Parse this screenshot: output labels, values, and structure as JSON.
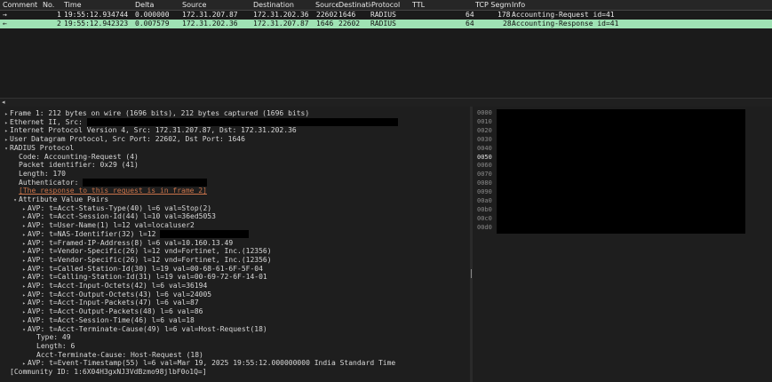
{
  "packet_list": {
    "columns": [
      "Comment",
      "No.",
      "Time",
      "Delta",
      "Source",
      "Destination",
      "Source",
      "Destinatio",
      "Protocol",
      "TTL",
      "TCP Segme",
      "Info"
    ],
    "rows": [
      {
        "arrow": "→",
        "no": "1",
        "time": "19:55:12.934744",
        "delta": "0.000000",
        "src": "172.31.207.87",
        "dst": "172.31.202.36",
        "sport": "22602",
        "dport": "1646",
        "proto": "RADIUS",
        "ttl": "64",
        "len": "178",
        "info": "Accounting-Request id=41"
      },
      {
        "arrow": "←",
        "no": "2",
        "time": "19:55:12.942323",
        "delta": "0.007579",
        "src": "172.31.202.36",
        "dst": "172.31.207.87",
        "sport": "1646",
        "dport": "22602",
        "proto": "RADIUS",
        "ttl": "64",
        "len": "28",
        "info": "Accounting-Response id=41"
      }
    ],
    "selected_row_color": "#9fe2b4"
  },
  "details": {
    "lines": [
      {
        "indent": 0,
        "tw": "▸",
        "text": "Frame 1: 212 bytes on wire (1696 bits), 212 bytes captured (1696 bits)"
      },
      {
        "indent": 0,
        "tw": "▸",
        "text": "Ethernet II, Src: ",
        "redact": 350
      },
      {
        "indent": 0,
        "tw": "▸",
        "text": "Internet Protocol Version 4, Src: 172.31.207.87, Dst: 172.31.202.36"
      },
      {
        "indent": 0,
        "tw": "▸",
        "text": "User Datagram Protocol, Src Port: 22602, Dst Port: 1646"
      },
      {
        "indent": 0,
        "tw": "▾",
        "text": "RADIUS Protocol"
      },
      {
        "indent": 1,
        "tw": "",
        "text": "Code: Accounting-Request (4)"
      },
      {
        "indent": 1,
        "tw": "",
        "text": "Packet identifier: 0x29 (41)"
      },
      {
        "indent": 1,
        "tw": "",
        "text": "Length: 170"
      },
      {
        "indent": 1,
        "tw": "",
        "text": "Authenticator: ",
        "redact": 140
      },
      {
        "indent": 1,
        "tw": "",
        "text": "[The response to this request is in frame 2]",
        "link": true
      },
      {
        "indent": 1,
        "tw": "▾",
        "text": "Attribute Value Pairs"
      },
      {
        "indent": 2,
        "tw": "▸",
        "text": "AVP: t=Acct-Status-Type(40) l=6 val=Stop(2)"
      },
      {
        "indent": 2,
        "tw": "▸",
        "text": "AVP: t=Acct-Session-Id(44) l=10 val=36ed5053"
      },
      {
        "indent": 2,
        "tw": "▸",
        "text": "AVP: t=User-Name(1) l=12 val=localuser2"
      },
      {
        "indent": 2,
        "tw": "▸",
        "text": "AVP: t=NAS-Identifier(32) l=12 ",
        "redact": 100
      },
      {
        "indent": 2,
        "tw": "▸",
        "text": "AVP: t=Framed-IP-Address(8) l=6 val=10.160.13.49"
      },
      {
        "indent": 2,
        "tw": "▸",
        "text": "AVP: t=Vendor-Specific(26) l=12 vnd=Fortinet, Inc.(12356)"
      },
      {
        "indent": 2,
        "tw": "▸",
        "text": "AVP: t=Vendor-Specific(26) l=12 vnd=Fortinet, Inc.(12356)"
      },
      {
        "indent": 2,
        "tw": "▸",
        "text": "AVP: t=Called-Station-Id(30) l=19 val=00-68-61-6F-5F-04"
      },
      {
        "indent": 2,
        "tw": "▸",
        "text": "AVP: t=Calling-Station-Id(31) l=19 val=00-69-72-6F-14-01"
      },
      {
        "indent": 2,
        "tw": "▸",
        "text": "AVP: t=Acct-Input-Octets(42) l=6 val=36194"
      },
      {
        "indent": 2,
        "tw": "▸",
        "text": "AVP: t=Acct-Output-Octets(43) l=6 val=24005"
      },
      {
        "indent": 2,
        "tw": "▸",
        "text": "AVP: t=Acct-Input-Packets(47) l=6 val=87"
      },
      {
        "indent": 2,
        "tw": "▸",
        "text": "AVP: t=Acct-Output-Packets(48) l=6 val=86"
      },
      {
        "indent": 2,
        "tw": "▸",
        "text": "AVP: t=Acct-Session-Time(46) l=6 val=18"
      },
      {
        "indent": 2,
        "tw": "▾",
        "text": "AVP: t=Acct-Terminate-Cause(49) l=6 val=Host-Request(18)"
      },
      {
        "indent": 3,
        "tw": "",
        "text": "Type: 49"
      },
      {
        "indent": 3,
        "tw": "",
        "text": "Length: 6"
      },
      {
        "indent": 3,
        "tw": "",
        "text": "Acct-Terminate-Cause: Host-Request (18)"
      },
      {
        "indent": 2,
        "tw": "▸",
        "text": "AVP: t=Event-Timestamp(55) l=6 val=Mar 19, 2025 19:55:12.000000000 India Standard Time"
      },
      {
        "indent": 0,
        "tw": "",
        "text": "[Community ID: 1:6X04H3gxNJ3VdBzmo98jlbF0o1Q=]"
      }
    ]
  },
  "bytes": {
    "offsets": [
      "0000",
      "0010",
      "0020",
      "0030",
      "0040",
      "0050",
      "0060",
      "0070",
      "0080",
      "0090",
      "00a0",
      "00b0",
      "00c0",
      "00d0"
    ],
    "highlight": "0050"
  }
}
